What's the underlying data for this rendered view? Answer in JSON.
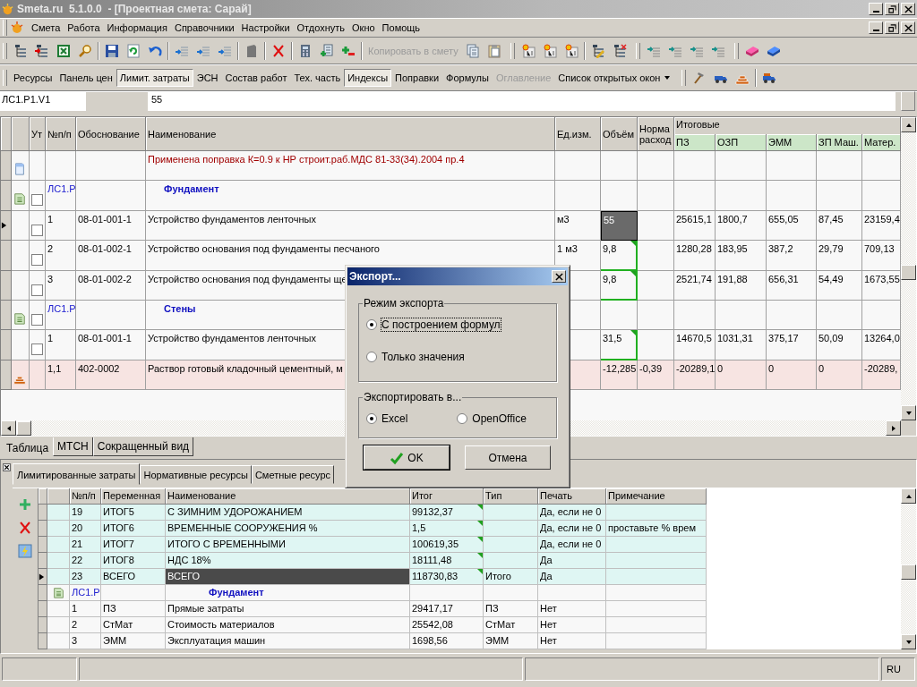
{
  "title_bar": {
    "title": "Smeta.ru  5.1.0.0  - [Проектная смета: Сарай]"
  },
  "menu": [
    "Смета",
    "Работа",
    "Информация",
    "Справочники",
    "Настройки",
    "Отдохнуть",
    "Окно",
    "Помощь"
  ],
  "toolbar": {
    "copy_button": {
      "label": "Копировать в смету",
      "disabled": true
    }
  },
  "view_toolbar": [
    {
      "label": "Ресурсы",
      "pressed": false,
      "disabled": false,
      "kind": "button"
    },
    {
      "label": "Панель цен",
      "pressed": false,
      "disabled": false,
      "kind": "button"
    },
    {
      "label": "Лимит. затраты",
      "pressed": true,
      "disabled": false,
      "kind": "button"
    },
    {
      "label": "ЭСН",
      "pressed": false,
      "disabled": false,
      "kind": "button"
    },
    {
      "label": "Состав работ",
      "pressed": false,
      "disabled": false,
      "kind": "button"
    },
    {
      "label": "Тех. часть",
      "pressed": false,
      "disabled": false,
      "kind": "button"
    },
    {
      "label": "Индексы",
      "pressed": true,
      "disabled": false,
      "kind": "button"
    },
    {
      "label": "Поправки",
      "pressed": false,
      "disabled": false,
      "kind": "button"
    },
    {
      "label": "Формулы",
      "pressed": false,
      "disabled": false,
      "kind": "button"
    },
    {
      "label": "Оглавление",
      "pressed": false,
      "disabled": true,
      "kind": "button"
    },
    {
      "label": "Список открытых окон",
      "pressed": false,
      "disabled": false,
      "kind": "dropdown"
    }
  ],
  "formula_bar": {
    "cell": "ЛС1.Р1.V1",
    "value": "55"
  },
  "main_table": {
    "columns": [
      "Ут",
      "№п/п",
      "Обоснование",
      "Наименование",
      "Ед.изм.",
      "Объём",
      "Норма расход"
    ],
    "group_header": "Итоговые",
    "group_columns": [
      "ПЗ",
      "ОЗП",
      "ЭММ",
      "ЗП Маш.",
      "Матер."
    ],
    "rows": [
      {
        "kind": "note",
        "current": false,
        "name": "Применена поправка К=0.9 к НР строит.раб.МДС 81-33(34).2004 пр.4"
      },
      {
        "kind": "section",
        "current": false,
        "checked": false,
        "no": "ЛС1.Р",
        "name": "Фундамент"
      },
      {
        "kind": "item",
        "current": true,
        "checked": false,
        "no": "1",
        "code": "08-01-001-1",
        "name": "Устройство фундаментов ленточных",
        "unit": "м3",
        "volume": "55",
        "formula": false,
        "totals": [
          "25615,1",
          "1800,7",
          "655,05",
          "87,45",
          "23159,4"
        ]
      },
      {
        "kind": "item",
        "current": false,
        "checked": false,
        "no": "2",
        "code": "08-01-002-1",
        "name": "Устройство основания под фундаменты песчаного",
        "unit": "1 м3",
        "volume": "9,8",
        "formula": true,
        "totals": [
          "1280,28",
          "183,95",
          "387,2",
          "29,79",
          "709,13"
        ]
      },
      {
        "kind": "item",
        "current": false,
        "checked": false,
        "no": "3",
        "code": "08-01-002-2",
        "name": "Устройство основания под фундаменты ще",
        "volume": "9,8",
        "formula": true,
        "totals": [
          "2521,74",
          "191,88",
          "656,31",
          "54,49",
          "1673,55"
        ]
      },
      {
        "kind": "section",
        "current": false,
        "checked": false,
        "no": "ЛС1.Р",
        "name": "Стены"
      },
      {
        "kind": "item",
        "current": false,
        "checked": false,
        "no": "1",
        "code": "08-01-001-1",
        "name": "Устройство фундаментов ленточных",
        "volume": "31,5",
        "formula": true,
        "totals": [
          "14670,5",
          "1031,31",
          "375,17",
          "50,09",
          "13264,0"
        ]
      },
      {
        "kind": "resource",
        "current": false,
        "no": "1,1",
        "code": "402-0002",
        "name": "Раствор готовый кладочный цементный, м",
        "volume": "-12,285",
        "formula": false,
        "norm": "-0,39",
        "totals": [
          "-20289,1",
          "0",
          "0",
          "0",
          "-20289,"
        ]
      }
    ]
  },
  "view_tabs": [
    {
      "label": "Таблица",
      "selected": true
    },
    {
      "label": "МТСН",
      "selected": false
    },
    {
      "label": "Сокращенный вид",
      "selected": false
    }
  ],
  "panel_tabs": [
    {
      "label": "Лимитированные затраты",
      "selected": true
    },
    {
      "label": "Нормативные ресурсы",
      "selected": false
    },
    {
      "label": "Сметные ресурс",
      "selected": false
    }
  ],
  "limits_table": {
    "columns": [
      "№п/п",
      "Переменная",
      "Наименование",
      "Итог",
      "Тип",
      "Печать",
      "Примечание"
    ],
    "rows": [
      {
        "kind": "total",
        "current": false,
        "no": "19",
        "variable": "ИТОГ5",
        "name": "С ЗИМНИМ УДОРОЖАНИЕМ",
        "total": "99132,37",
        "formula": true,
        "print": "Да, если не 0"
      },
      {
        "kind": "total",
        "current": false,
        "no": "20",
        "variable": "ИТОГ6",
        "name": "ВРЕМЕННЫЕ СООРУЖЕНИЯ %",
        "total": "1,5",
        "formula": true,
        "print": "Да, если не 0",
        "note": "проставьте % врем"
      },
      {
        "kind": "total",
        "current": false,
        "no": "21",
        "variable": "ИТОГ7",
        "name": "ИТОГО С ВРЕМЕННЫМИ",
        "total": "100619,35",
        "formula": true,
        "print": "Да, если не 0"
      },
      {
        "kind": "total",
        "current": false,
        "no": "22",
        "variable": "ИТОГ8",
        "name": "НДС 18%",
        "total": "18111,48",
        "formula": true,
        "print": "Да"
      },
      {
        "kind": "total",
        "current": true,
        "no": "23",
        "variable": "ВСЕГО",
        "name": "ВСЕГО",
        "total": "118730,83",
        "formula": true,
        "type": "Итого",
        "print": "Да"
      },
      {
        "kind": "section",
        "current": false,
        "no": "ЛС1.Р",
        "name": "Фундамент"
      },
      {
        "kind": "item",
        "current": false,
        "no": "1",
        "variable": "ПЗ",
        "name": "Прямые затраты",
        "total": "29417,17",
        "formula": false,
        "type": "ПЗ",
        "print": "Нет"
      },
      {
        "kind": "item",
        "current": false,
        "no": "2",
        "variable": "СтМат",
        "name": "Стоимость материалов",
        "total": "25542,08",
        "formula": false,
        "type": "СтМат",
        "print": "Нет"
      },
      {
        "kind": "item",
        "current": false,
        "no": "3",
        "variable": "ЭММ",
        "name": "Эксплуатация машин",
        "total": "1698,56",
        "formula": false,
        "type": "ЭММ",
        "print": "Нет"
      }
    ]
  },
  "status_bar": {
    "language": "RU"
  },
  "export_dialog": {
    "title": "Экспорт...",
    "mode_group": {
      "label": "Режим экспорта",
      "options": [
        {
          "label": "С построением формул",
          "selected": true
        },
        {
          "label": "Только значения",
          "selected": false
        }
      ]
    },
    "target_group": {
      "label": "Экспортировать в...",
      "options": [
        {
          "label": "Excel",
          "selected": true
        },
        {
          "label": "OpenOffice",
          "selected": false
        }
      ]
    },
    "buttons": [
      {
        "label": "OK",
        "kind": "ok"
      },
      {
        "label": "Отмена",
        "kind": "cancel"
      }
    ]
  }
}
